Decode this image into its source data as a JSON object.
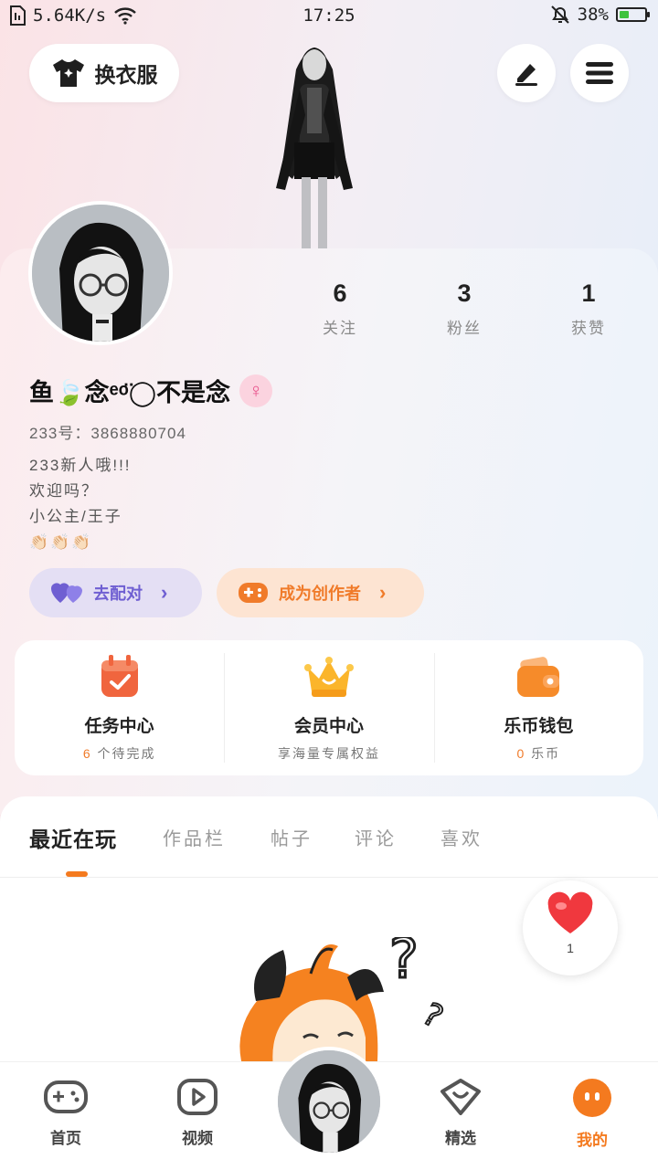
{
  "status_bar": {
    "network_speed": "5.64K/s",
    "time": "17:25",
    "battery_percent": "38%",
    "battery_level": 0.38
  },
  "top_bar": {
    "outfit_label": "换衣服"
  },
  "profile": {
    "stats": [
      {
        "value": "6",
        "label": "关注"
      },
      {
        "value": "3",
        "label": "粉丝"
      },
      {
        "value": "1",
        "label": "获赞"
      }
    ],
    "username": "鱼🍃念ᵉᵒ̈◯不是念",
    "uid": "233号：3868880704",
    "bio": [
      "233新人哦!!!",
      "欢迎吗？",
      "小公主/王子",
      "👏🏻👏🏻👏🏻"
    ],
    "match_label": "去配对",
    "creator_label": "成为创作者"
  },
  "features": [
    {
      "title": "任务中心",
      "sub_value": "6",
      "sub_text": " 个待完成",
      "icon": "calendar-check-icon",
      "color": "#f0653e"
    },
    {
      "title": "会员中心",
      "sub_value": "",
      "sub_text": "享海量专属权益",
      "icon": "crown-icon",
      "color": "#fbb52b"
    },
    {
      "title": "乐币钱包",
      "sub_value": "0",
      "sub_text": " 乐币",
      "icon": "wallet-icon",
      "color": "#f68b2a"
    }
  ],
  "tabs": [
    {
      "label": "最近在玩",
      "active": true
    },
    {
      "label": "作品栏",
      "active": false
    },
    {
      "label": "帖子",
      "active": false
    },
    {
      "label": "评论",
      "active": false
    },
    {
      "label": "喜欢",
      "active": false
    }
  ],
  "favorite_float": {
    "count": "1"
  },
  "bottom_nav": [
    {
      "label": "首页",
      "icon": "gamepad-icon"
    },
    {
      "label": "视频",
      "icon": "play-icon"
    },
    {
      "label": "精选",
      "icon": "heart-bag-icon"
    },
    {
      "label": "我的",
      "icon": "face-icon",
      "active": true
    }
  ],
  "colors": {
    "accent": "#f47a1f",
    "match": "#6f5fd2",
    "creator": "#f07b2a"
  }
}
